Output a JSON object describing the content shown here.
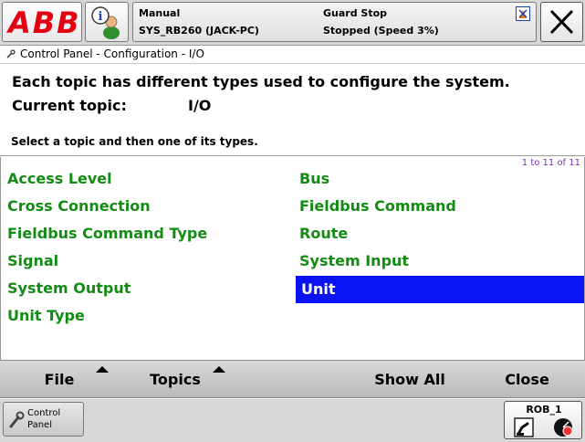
{
  "topbar": {
    "logo_text": "ABB",
    "mode": "Manual",
    "system_name": "SYS_RB260 (JACK-PC)",
    "guard_status": "Guard Stop",
    "run_state": "Stopped (Speed 3%)",
    "icons": [
      "abb-logo",
      "info-user-icon",
      "status-flag-icon",
      "close-x-icon"
    ]
  },
  "breadcrumb": {
    "text": "Control Panel - Configuration - I/O",
    "icon": "tools-icon"
  },
  "intro": {
    "description": "Each topic has different types used to configure the system.",
    "current_label": "Current topic:",
    "current_value": "I/O",
    "instruction": "Select a topic and then one of its types."
  },
  "list": {
    "pager": "1 to 11 of 11",
    "items": [
      "Access Level",
      "Bus",
      "Cross Connection",
      "Fieldbus Command",
      "Fieldbus Command Type",
      "Route",
      "Signal",
      "System Input",
      "System Output",
      "Unit",
      "Unit Type"
    ],
    "selected": "Unit",
    "colors": {
      "item": "#138c13",
      "selected_bg": "#0a13f2",
      "selected_text": "#ffffff"
    }
  },
  "commands": {
    "file": "File",
    "topics": "Topics",
    "show_all": "Show All",
    "close": "Close"
  },
  "taskbar": {
    "control_panel_label": "Control Panel",
    "control_panel_icon": "wrench-icon",
    "robot_label": "ROB_1",
    "robot_icons": [
      "robot-arm-icon",
      "speed-gauge-icon"
    ]
  }
}
